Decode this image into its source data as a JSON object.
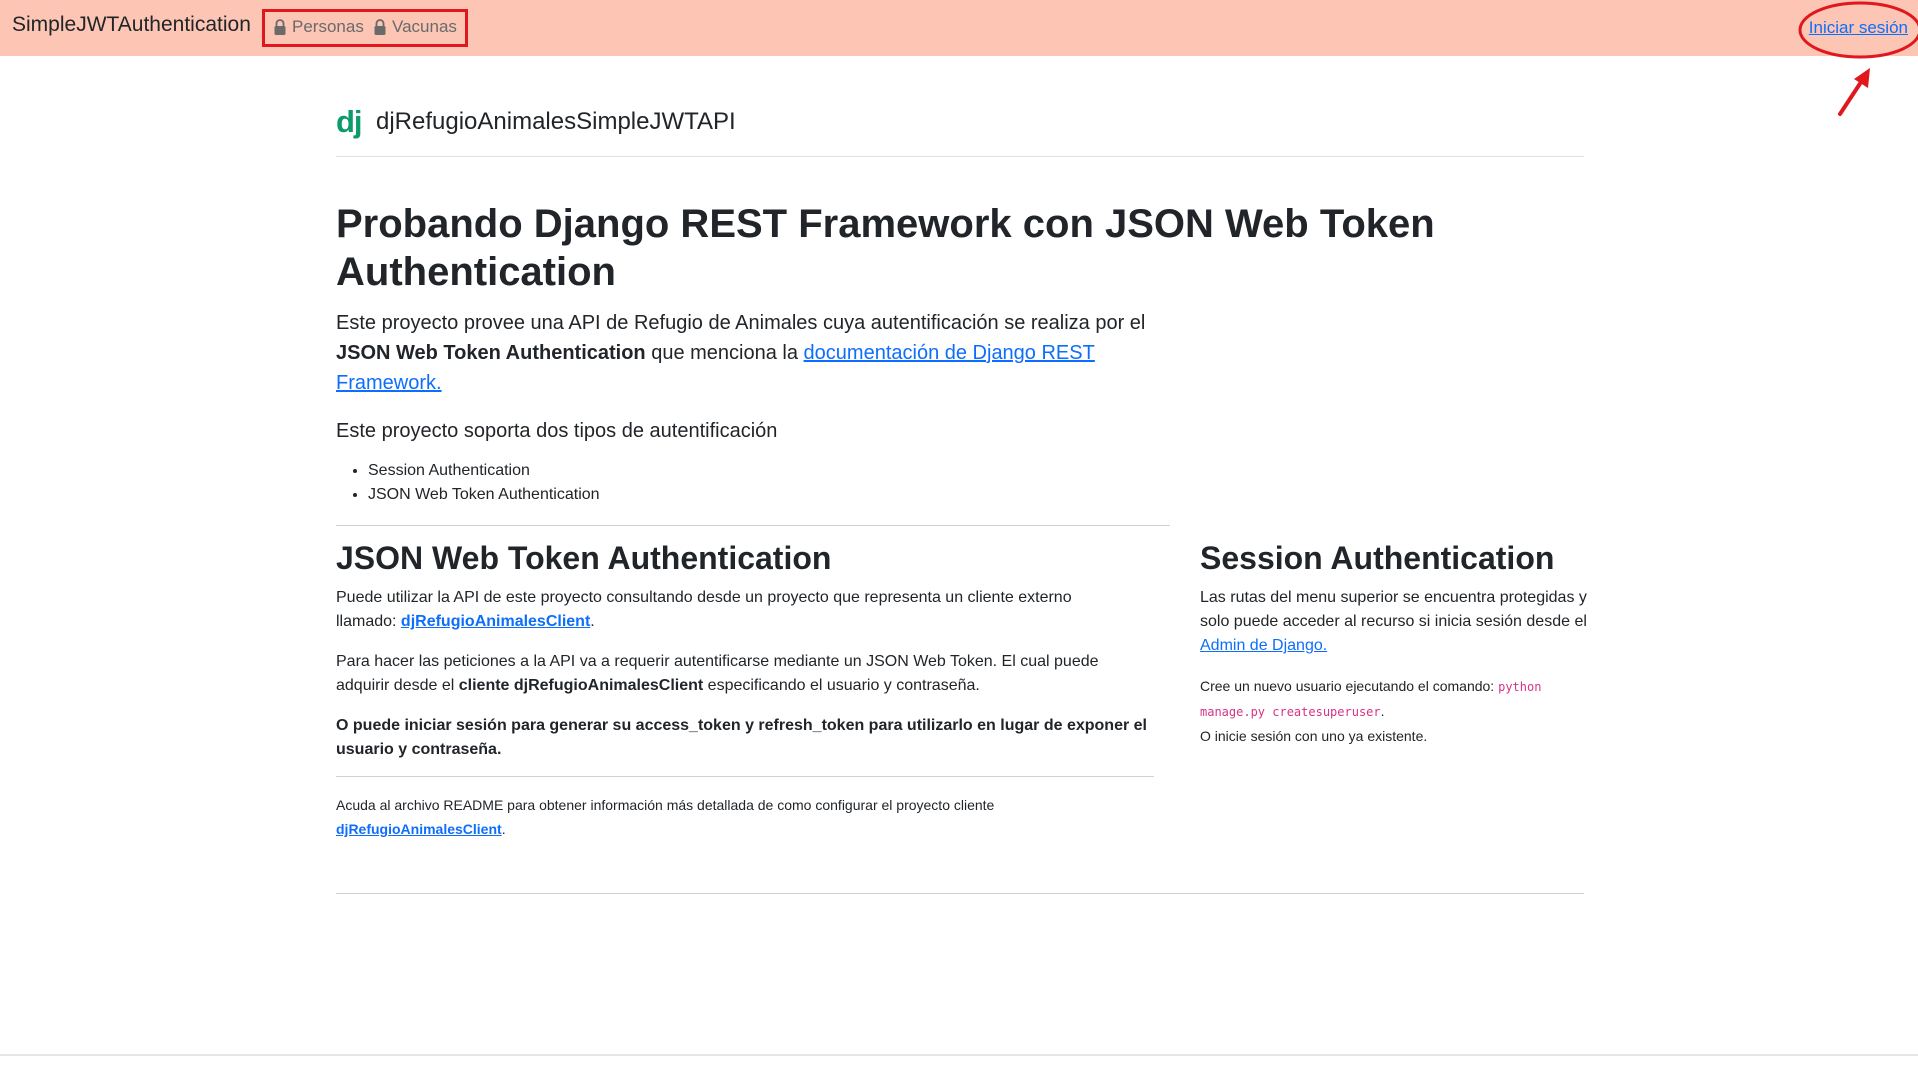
{
  "navbar": {
    "brand": "SimpleJWTAuthentication",
    "items": [
      {
        "label": "Personas",
        "icon": "lock-icon"
      },
      {
        "label": "Vacunas",
        "icon": "lock-icon"
      }
    ],
    "login": "Iniciar sesión",
    "background": "#fcc5b4"
  },
  "site": {
    "logo": "dj",
    "name": "djRefugioAnimalesSimpleJWTAPI"
  },
  "hero": {
    "title": "Probando Django REST Framework con JSON Web Token Authentication",
    "lead_part1": "Este proyecto provee una API de Refugio de Animales cuya autentificación se realiza por el ",
    "lead_bold": "JSON Web Token Authentication",
    "lead_part2": " que menciona la ",
    "lead_link": "documentación de Django REST Framework.",
    "supports": "Este proyecto soporta dos tipos de autentificación",
    "auth_types": [
      "Session Authentication",
      "JSON Web Token Authentication"
    ]
  },
  "jwt": {
    "title": "JSON Web Token Authentication",
    "p1_text": "Puede utilizar la API de este proyecto consultando desde un proyecto que representa un cliente externo llamado: ",
    "p1_link": "djRefugioAnimalesClient",
    "p2_text1": "Para hacer las peticiones a la API va a requerir autentificarse mediante un JSON Web Token. El cual puede adquirir desde el ",
    "p2_bold": "cliente djRefugioAnimalesClient",
    "p2_text2": " especificando el usuario y contraseña.",
    "p3_bold": "O puede iniciar sesión para generar su access_token y refresh_token para utilizarlo en lugar de exponer el usuario y contraseña.",
    "readme_text": "Acuda al archivo README para obtener información más detallada de como configurar el proyecto cliente ",
    "readme_link": "djRefugioAnimalesClient"
  },
  "session": {
    "title": "Session Authentication",
    "p1_text": "Las rutas del menu superior se encuentra protegidas y solo puede acceder al recurso si inicia sesión desde el ",
    "p1_link": "Admin de Django.",
    "p2_text": "Cree un nuevo usuario ejecutando el comando: ",
    "p2_code": "python manage.py createsuperuser",
    "p2_text2": "O inicie sesión con uno ya existente."
  },
  "colors": {
    "link": "#0d6efd",
    "annotation": "#e0171d",
    "django_green": "#0c9b6b",
    "code": "#d63384"
  }
}
